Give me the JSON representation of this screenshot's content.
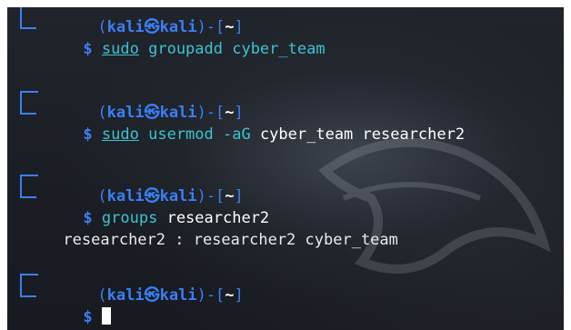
{
  "prompt": {
    "user": "kali",
    "separator": "㉿",
    "host": "kali",
    "open": "(",
    "close": ")-[",
    "dir": "~",
    "dir_close": "]",
    "symbol": "$"
  },
  "history": [
    {
      "cmd_sudo": "sudo",
      "cmd_rest": " groupadd cyber_team"
    },
    {
      "cmd_sudo": "sudo",
      "cmd_rest_prefix": " usermod -aG ",
      "cmd_rest_args": "cyber_team researcher2"
    },
    {
      "cmd_name": "groups",
      "cmd_args": " researcher2",
      "output": "researcher2 : researcher2 cyber_team"
    }
  ],
  "colors": {
    "prompt_blue": "#3b7ff5",
    "command_cyan": "#3ec2d2",
    "text": "#e8ecf0",
    "background": "#1b1f25"
  }
}
